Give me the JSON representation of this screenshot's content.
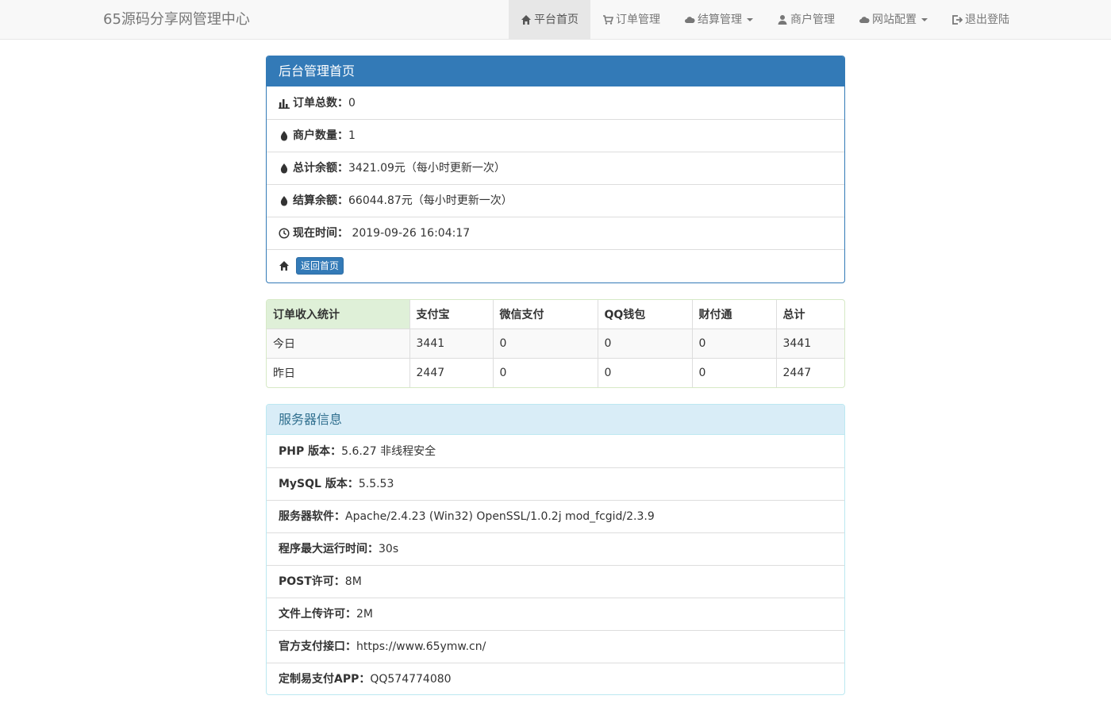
{
  "navbar": {
    "brand": "65源码分享网管理中心",
    "items": [
      {
        "label": "平台首页",
        "icon": "home-icon",
        "active": true,
        "dropdown": false
      },
      {
        "label": "订单管理",
        "icon": "cart-icon",
        "active": false,
        "dropdown": false
      },
      {
        "label": "结算管理",
        "icon": "cloud-icon",
        "active": false,
        "dropdown": true
      },
      {
        "label": "商户管理",
        "icon": "user-icon",
        "active": false,
        "dropdown": false
      },
      {
        "label": "网站配置",
        "icon": "cloud-icon",
        "active": false,
        "dropdown": true
      },
      {
        "label": "退出登陆",
        "icon": "logout-icon",
        "active": false,
        "dropdown": false
      }
    ]
  },
  "admin_panel": {
    "title": "后台管理首页",
    "rows": [
      {
        "icon": "stats-icon",
        "label": "订单总数：",
        "value": "0"
      },
      {
        "icon": "drop-icon",
        "label": "商户数量：",
        "value": "1"
      },
      {
        "icon": "drop-icon",
        "label": "总计余额：",
        "value": "3421.09元（每小时更新一次）"
      },
      {
        "icon": "drop-icon",
        "label": "结算余额：",
        "value": "66044.87元（每小时更新一次）"
      },
      {
        "icon": "clock-icon",
        "label": "现在时间：",
        "value": " 2019-09-26 16:04:17"
      }
    ],
    "home_button": "返回首页"
  },
  "stats_table": {
    "headers": [
      "订单收入统计",
      "支付宝",
      "微信支付",
      "QQ钱包",
      "财付通",
      "总计"
    ],
    "rows": [
      [
        "今日",
        "3441",
        "0",
        "0",
        "0",
        "3441"
      ],
      [
        "昨日",
        "2447",
        "0",
        "0",
        "0",
        "2447"
      ]
    ]
  },
  "server_panel": {
    "title": "服务器信息",
    "rows": [
      {
        "label": "PHP 版本：",
        "value": "5.6.27 非线程安全"
      },
      {
        "label": "MySQL 版本：",
        "value": "5.5.53"
      },
      {
        "label": "服务器软件：",
        "value": "Apache/2.4.23 (Win32) OpenSSL/1.0.2j mod_fcgid/2.3.9"
      },
      {
        "label": "程序最大运行时间：",
        "value": "30s"
      },
      {
        "label": "POST许可：",
        "value": "8M"
      },
      {
        "label": "文件上传许可：",
        "value": "2M"
      },
      {
        "label": "官方支付接口：",
        "value": "https://www.65ymw.cn/"
      },
      {
        "label": "定制易支付APP：",
        "value": "QQ574774080"
      }
    ]
  },
  "colors": {
    "primary": "#337ab7",
    "info_bg": "#d9edf7",
    "success_bg": "#dff0d8",
    "navbar_bg": "#f8f8f8"
  }
}
